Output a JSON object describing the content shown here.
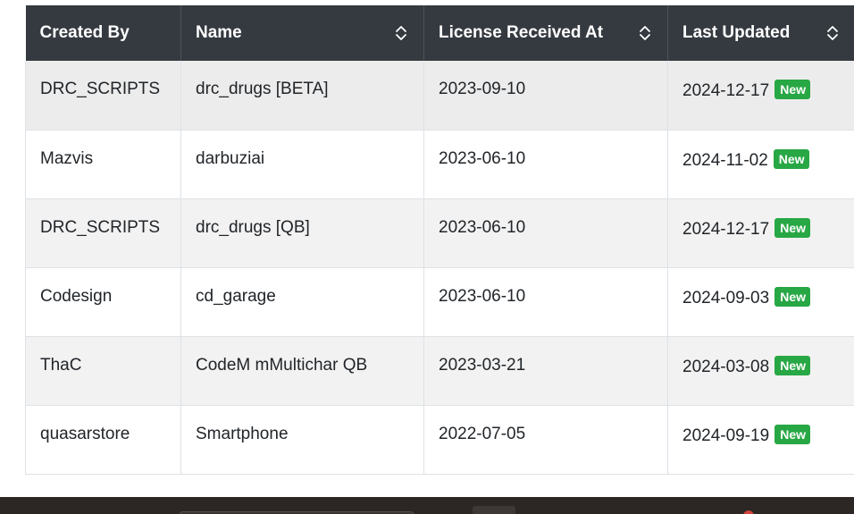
{
  "table": {
    "columns": [
      {
        "label": "Created By",
        "sortable": false
      },
      {
        "label": "Name",
        "sortable": true
      },
      {
        "label": "License Received At",
        "sortable": true
      },
      {
        "label": "Last Updated",
        "sortable": true
      }
    ],
    "badge_color": "#28a745",
    "header_color": "#343a40",
    "rows": [
      {
        "created_by": "DRC_SCRIPTS",
        "name": "drc_drugs [BETA]",
        "license_received_at": "2023-09-10",
        "last_updated": "2024-12-17",
        "badge": "New"
      },
      {
        "created_by": "Mazvis",
        "name": "darbuziai",
        "license_received_at": "2023-06-10",
        "last_updated": "2024-11-02",
        "badge": "New"
      },
      {
        "created_by": "DRC_SCRIPTS",
        "name": "drc_drugs [QB]",
        "license_received_at": "2023-06-10",
        "last_updated": "2024-12-17",
        "badge": "New"
      },
      {
        "created_by": "Codesign",
        "name": "cd_garage",
        "license_received_at": "2023-06-10",
        "last_updated": "2024-09-03",
        "badge": "New"
      },
      {
        "created_by": "ThaC",
        "name": "CodeM mMultichar QB",
        "license_received_at": "2023-03-21",
        "last_updated": "2024-03-08",
        "badge": "New"
      },
      {
        "created_by": "quasarstore",
        "name": "Smartphone",
        "license_received_at": "2022-07-05",
        "last_updated": "2024-09-19",
        "badge": "New"
      }
    ]
  }
}
